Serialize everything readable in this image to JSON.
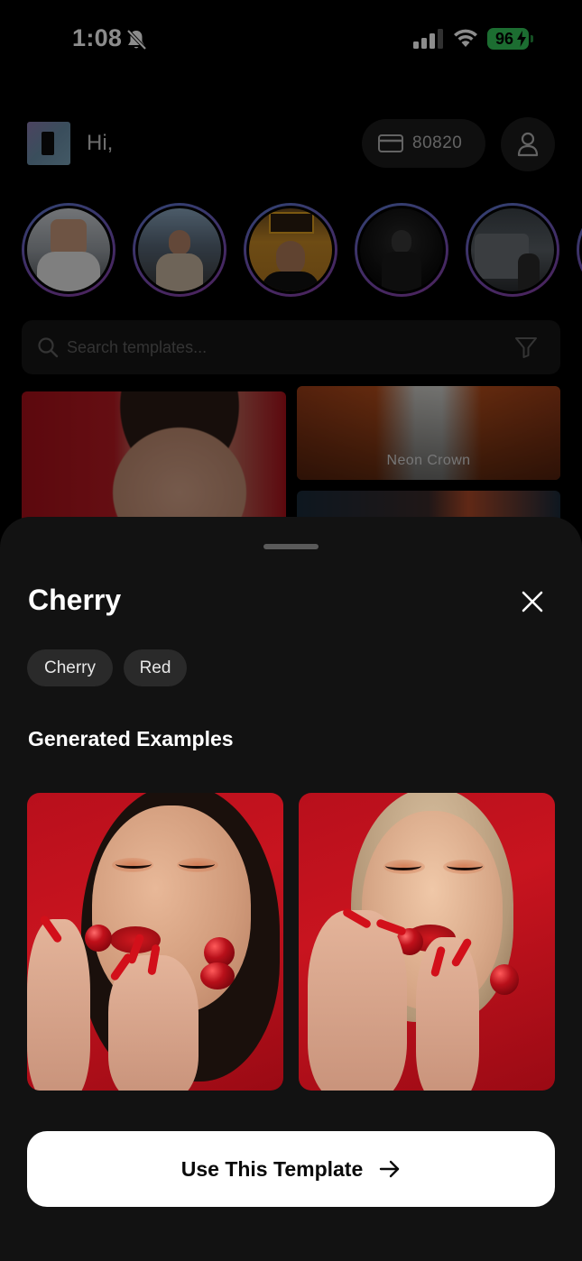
{
  "status_bar": {
    "time": "1:08",
    "battery": "96",
    "colors": {
      "battery": "#34c759"
    }
  },
  "header": {
    "greeting": "Hi,",
    "credits": "80820"
  },
  "stories": [
    {
      "name": "story-1"
    },
    {
      "name": "story-2"
    },
    {
      "name": "story-3"
    },
    {
      "name": "story-4"
    },
    {
      "name": "story-5"
    }
  ],
  "search": {
    "placeholder": "Search templates...",
    "value": ""
  },
  "grid": {
    "cards": [
      {
        "label": ""
      },
      {
        "label": "Neon Crown"
      }
    ]
  },
  "sheet": {
    "title": "Cherry",
    "tags": [
      "Cherry",
      "Red"
    ],
    "section_title": "Generated Examples",
    "cta_label": "Use This Template"
  },
  "icons": {
    "status": [
      "bell-slash-icon",
      "cellular-signal-icon",
      "wifi-icon",
      "battery-icon"
    ],
    "header": [
      "credit-card-icon",
      "person-icon"
    ],
    "search": [
      "search-icon",
      "filter-icon"
    ],
    "sheet": [
      "close-icon",
      "arrow-right-icon"
    ]
  },
  "colors": {
    "background": "#000000",
    "sheet": "#121212",
    "chip": "#2a2a2a",
    "cta": "#ffffff",
    "story_ring_start": "#5a7ad0",
    "story_ring_end": "#8a3fa8"
  }
}
